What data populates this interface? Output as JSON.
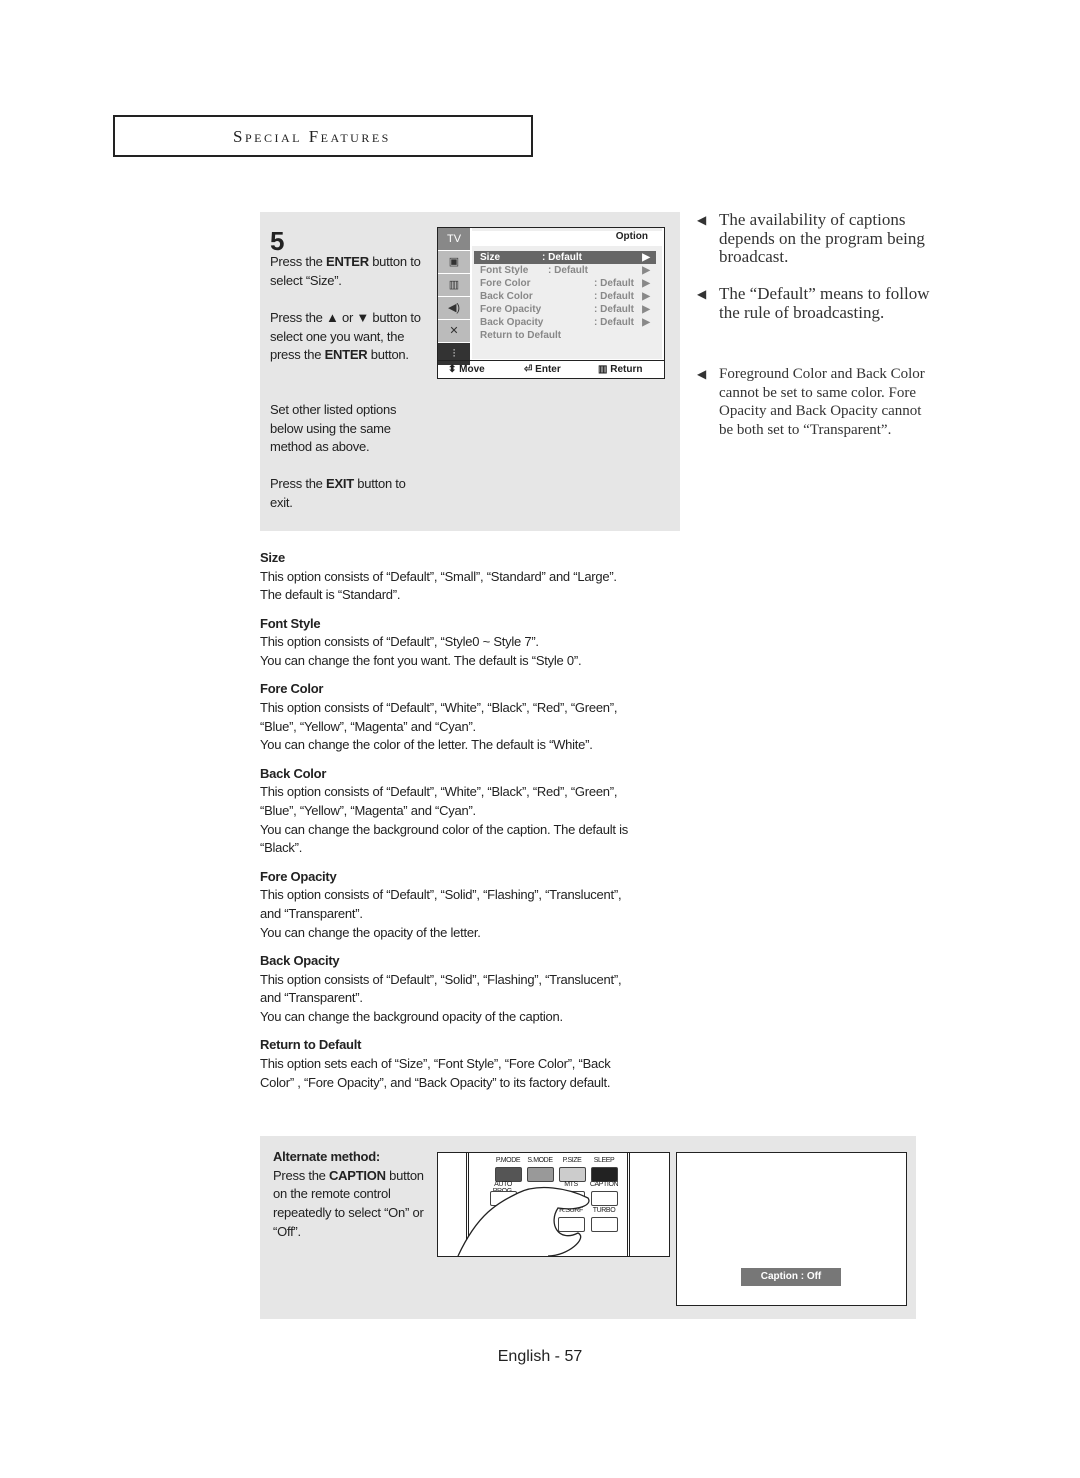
{
  "header": {
    "section_title": "Special Features"
  },
  "step": {
    "number": "5",
    "p1": [
      "Press the ",
      "ENTER",
      " button to select “Size”."
    ],
    "p2": [
      "Press the ▲ or ▼ button to select  one you want, the press the ",
      "ENTER",
      " button."
    ],
    "p3": "Set other listed options below using the same method as above.",
    "p4": [
      "Press the ",
      "EXIT",
      " button to exit."
    ]
  },
  "osd": {
    "side_label": "TV",
    "title": "Option",
    "rows": [
      {
        "label": "Size",
        "value": ": Default"
      },
      {
        "label": "Font Style",
        "value": ": Default"
      },
      {
        "label": "Fore Color",
        "value": ": Default"
      },
      {
        "label": "Back Color",
        "value": ": Default"
      },
      {
        "label": "Fore Opacity",
        "value": ": Default"
      },
      {
        "label": "Back Opacity",
        "value": ": Default"
      },
      {
        "label": "Return to Default",
        "value": ""
      }
    ],
    "footer": {
      "move": "Move",
      "enter": "Enter",
      "return": "Return"
    }
  },
  "notes": [
    "The availability of captions depends on the program being broadcast.",
    "The “Default” means to follow the rule of broadcasting.",
    "Foreground Color and Back Color cannot be set to same color. Fore Opacity and Back Opacity cannot be both set to “Transparent”."
  ],
  "sections": [
    {
      "title": "Size",
      "lines": [
        "This option consists of “Default”, “Small”, “Standard” and “Large”.",
        "The default is “Standard”."
      ]
    },
    {
      "title": "Font Style",
      "lines": [
        "This option consists of “Default”, “Style0 ~ Style 7”.",
        "You can change the font you want. The default is “Style 0”."
      ]
    },
    {
      "title": "Fore Color",
      "lines": [
        "This option consists of “Default”, “White”, “Black”, “Red”, “Green”,",
        "“Blue”, “Yellow”, “Magenta” and “Cyan”.",
        "You can change the color of the letter. The default is “White”."
      ]
    },
    {
      "title": "Back Color",
      "lines": [
        "This option consists of “Default”, “White”, “Black”, “Red”, “Green”,",
        "“Blue”, “Yellow”, “Magenta” and “Cyan”.",
        "You can change the background color of the caption. The default is",
        "“Black”."
      ]
    },
    {
      "title": "Fore Opacity",
      "lines": [
        "This option consists of “Default”, “Solid”, “Flashing”, “Translucent”,",
        "and “Transparent”.",
        "You can change the opacity of the letter."
      ]
    },
    {
      "title": "Back Opacity",
      "lines": [
        "This option consists of “Default”, “Solid”, “Flashing”, “Translucent”,",
        "and “Transparent”.",
        "You can change the background opacity of the caption."
      ]
    },
    {
      "title": "Return to Default",
      "lines": [
        "This option sets each of “Size”, “Font Style”, “Fore Color”, “Back",
        "Color” , “Fore Opacity”, and “Back Opacity” to its factory default."
      ]
    }
  ],
  "alternate": {
    "title": "Alternate method:",
    "text": [
      "Press the ",
      "CAPTION",
      " button on the remote control repeatedly to select “On” or “Off”."
    ],
    "remote_buttons": [
      "P.MODE",
      "S.MODE",
      "P.SIZE",
      "SLEEP",
      "AUTO PROG.",
      "MTS",
      "CAPTION",
      "R.SURF",
      "TURBO"
    ],
    "caption_osd": "Caption : Off"
  },
  "footer": {
    "page": "English - 57"
  }
}
